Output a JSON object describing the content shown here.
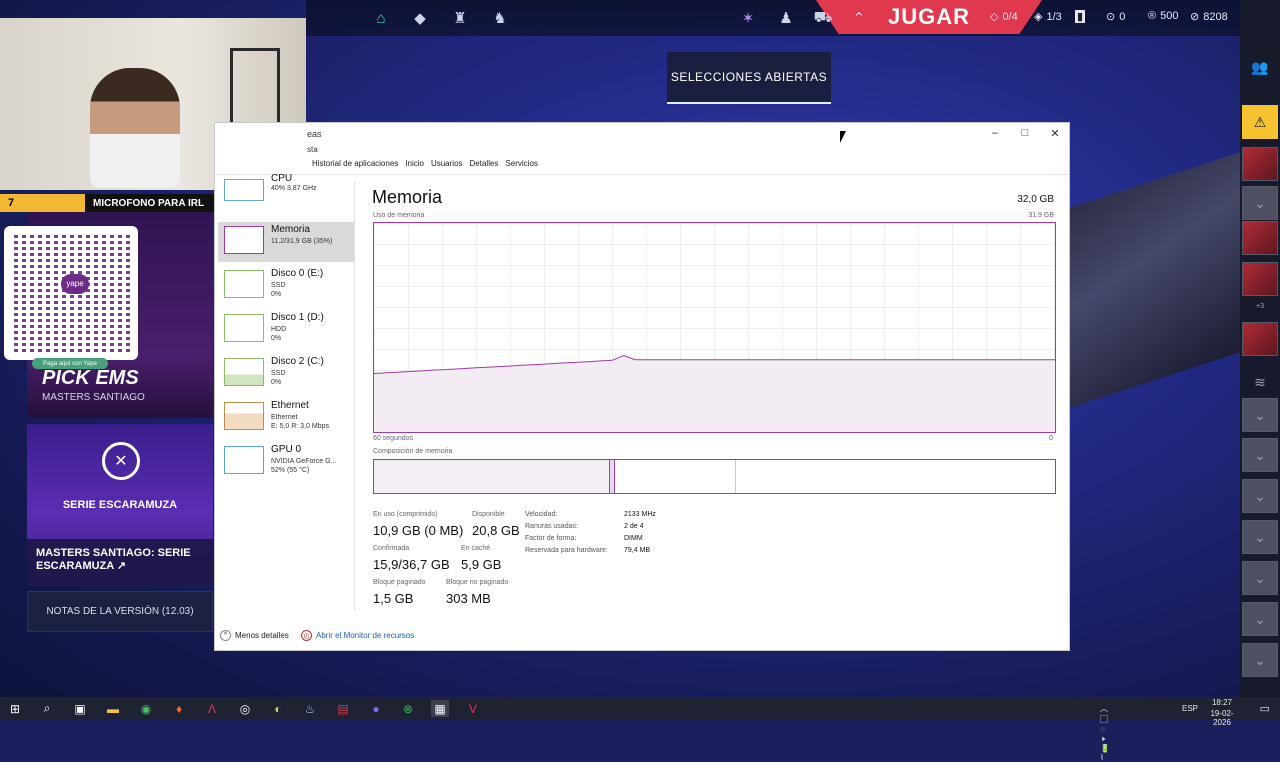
{
  "game": {
    "play_label": "JUGAR",
    "open_selections": "SELECCIONES ABIERTAS",
    "stats": [
      {
        "icon": "diamond-icon",
        "value": "0/4"
      },
      {
        "icon": "level-icon",
        "value": "1/3"
      },
      {
        "icon": "token-icon",
        "value": "0"
      },
      {
        "icon": "radianite-icon",
        "value": "500"
      },
      {
        "icon": "vp-icon",
        "value": "8208"
      }
    ],
    "notes_label": "NOTAS DE LA VERSIÓN (12.03)",
    "promo_title": "PICK EMS",
    "promo_sub": "MASTERS SANTIAGO",
    "serie_name": "SERIE ESCARAMUZA",
    "serie_card": "MASTERS SANTIAGO: SERIE ESCARAMUZA",
    "sidebar_count": "+3"
  },
  "stream": {
    "mic_number": "7",
    "mic_text": "MICROFONO PARA IRL",
    "yape_pill": "Paga aquí con Yape",
    "yape_brand": "yape"
  },
  "taskmanager": {
    "title": "eas",
    "menu": "sta",
    "tabs": [
      "Historial de aplicaciones",
      "Inicio",
      "Usuarios",
      "Detalles",
      "Servicios"
    ],
    "side": [
      {
        "name": "CPU",
        "d1": "40% 3,87 GHz",
        "d2": ""
      },
      {
        "name": "Memoria",
        "d1": "11,2/31,9 GB (35%)",
        "d2": ""
      },
      {
        "name": "Disco 0 (E:)",
        "d1": "SSD",
        "d2": "0%"
      },
      {
        "name": "Disco 1 (D:)",
        "d1": "HDD",
        "d2": "0%"
      },
      {
        "name": "Disco 2 (C:)",
        "d1": "SSD",
        "d2": "0%"
      },
      {
        "name": "Ethernet",
        "d1": "Ethernet",
        "d2": "E: 5,0 R: 3,0 Mbps"
      },
      {
        "name": "GPU 0",
        "d1": "NVIDIA GeForce G...",
        "d2": "52% (55 °C)"
      }
    ],
    "heading": "Memoria",
    "total": "32,0 GB",
    "usage_label": "Uso de memoria",
    "usage_max": "31,9 GB",
    "axis_left": "60 segundos",
    "axis_right": "0",
    "composition_label": "Composición de memoria",
    "stats": [
      {
        "label": "En uso (comprimido)",
        "value": "10,9 GB (0 MB)"
      },
      {
        "label": "Disponible",
        "value": "20,8 GB"
      },
      {
        "label": "Confirmada",
        "value": "15,9/36,7 GB"
      },
      {
        "label": "En caché",
        "value": "5,9 GB"
      },
      {
        "label": "Bloque paginado",
        "value": "1,5 GB"
      },
      {
        "label": "Bloque no paginado",
        "value": "303 MB"
      }
    ],
    "props": [
      {
        "k": "Velocidad:",
        "v": "2133 MHz"
      },
      {
        "k": "Ranuras usadas:",
        "v": "2 de 4"
      },
      {
        "k": "Factor de forma:",
        "v": "DIMM"
      },
      {
        "k": "Reservada para hardware:",
        "v": "79,4 MB"
      }
    ],
    "fewer_details": "Menos detalles",
    "resource_monitor": "Abrir el Monitor de recursos",
    "memory_usage_fraction": 0.35
  },
  "taskbar": {
    "lang": "ESP",
    "time": "18:27",
    "date": "19-02-2026"
  },
  "colors": {
    "accent_play": "#e0384f",
    "memory_purple": "#a13ca6"
  }
}
